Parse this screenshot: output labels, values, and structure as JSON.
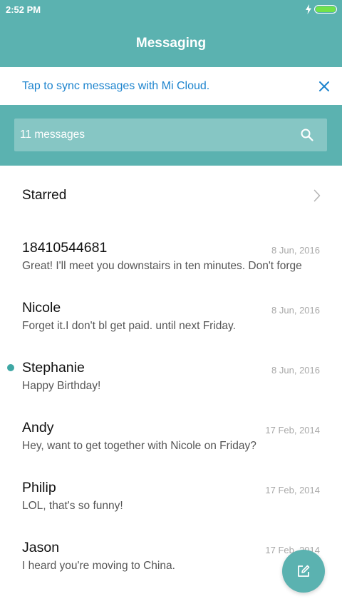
{
  "status_bar": {
    "time": "2:52 PM"
  },
  "app_bar": {
    "title": "Messaging"
  },
  "sync_banner": {
    "text": "Tap to sync messages with Mi Cloud."
  },
  "search": {
    "placeholder": "11 messages"
  },
  "starred": {
    "label": "Starred"
  },
  "messages": [
    {
      "name": "18410544681",
      "date": "8 Jun, 2016",
      "preview": "Great! I'll meet you downstairs in ten minutes. Don't forge",
      "unread": false
    },
    {
      "name": "Nicole",
      "date": "8 Jun, 2016",
      "preview": "Forget it.I don't bl get paid. until next Friday.",
      "unread": false
    },
    {
      "name": "Stephanie",
      "date": "8 Jun, 2016",
      "preview": "Happy Birthday!",
      "unread": true
    },
    {
      "name": "Andy",
      "date": "17 Feb, 2014",
      "preview": "Hey, want to get together with Nicole on Friday?",
      "unread": false
    },
    {
      "name": "Philip",
      "date": "17 Feb, 2014",
      "preview": "LOL, that's so funny!",
      "unread": false
    },
    {
      "name": "Jason",
      "date": "17 Feb, 2014",
      "preview": "I heard you're moving to China.",
      "unread": false
    }
  ],
  "colors": {
    "accent": "#5bb2b0",
    "sync_link": "#1d84ce",
    "unread_dot": "#3ea7a4",
    "battery": "#72e24a"
  },
  "icons": {
    "charging": "bolt-icon",
    "battery": "battery-icon",
    "close": "close-icon",
    "search": "search-icon",
    "chevron": "chevron-right-icon",
    "compose": "compose-icon"
  }
}
